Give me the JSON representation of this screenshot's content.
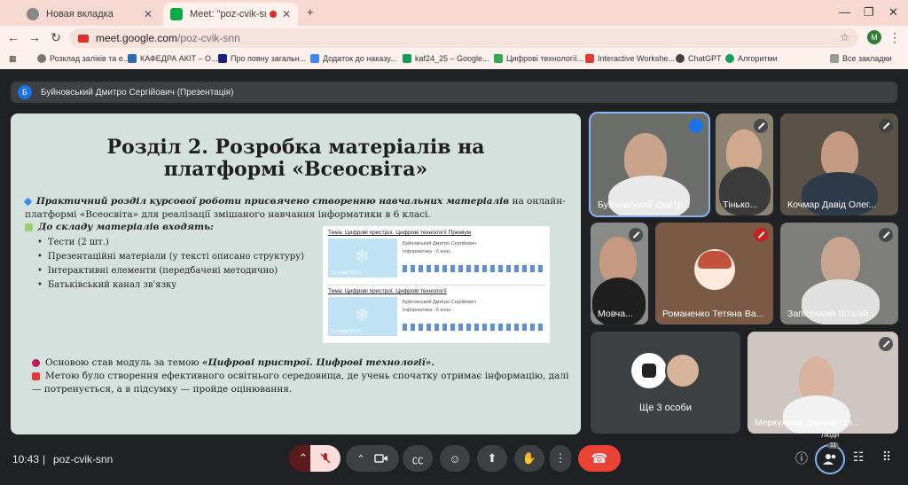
{
  "browser": {
    "tabs": [
      {
        "title": "Новая вкладка"
      },
      {
        "title": "Meet: \"poz-cvik-snn\""
      }
    ],
    "url_host": "meet.google.com",
    "url_path": "/poz-cvik-snn",
    "profile_initial": "M",
    "bookmarks": [
      "Розклад заліків та е...",
      "КАФЕДРА АКІТ – О...",
      "Про повну загальн...",
      "Додаток до наказу...",
      "kaf24_25 – Google...",
      "Цифрові технології...",
      "Interactive Workshe...",
      "ChatGPT",
      "Алгоритми"
    ],
    "all_bookmarks": "Все закладки"
  },
  "meet": {
    "presenter_initial": "Б",
    "presenter_title": "Буйновський Дмитро Сергійович (Презентація)",
    "time": "10:43",
    "meeting_code": "poz-cvik-snn",
    "people_label": "Люди",
    "people_count": "11",
    "more_label": "Ще 3 особи"
  },
  "slide": {
    "title_line1": "Розділ 2. Розробка матеріалів на",
    "title_line2": "платформі «Всеосвіта»",
    "para1_bold": "Практичний розділ курсової роботи присвячено створенню навчальних матеріалів",
    "para1_rest": " на онлайн-платформі «Всеосвіта» для реалізації змішаного навчання інформатики в 6 класі.",
    "includes": "До складу матеріалів входять:",
    "items": [
      "Тести (2 шт.)",
      "Презентаційні матеріали (у тексті описано структуру)",
      "Інтерактивні елементи (передбачені методично)",
      "Батьківський канал зв'язку"
    ],
    "base_text": "Основою став модуль за темою ",
    "base_bold": "«Цифрові пристрої. Цифрові технології».",
    "goal_text": "Метою було створення ефективного освітнього середовища, де учень спочатку отримає інформацію, далі — потренується, а в підсумку — пройде оцінювання.",
    "card1_title": "Тема: Цифрові пристрої. Цифрові технології Преміум",
    "card2_title": "Тема: Цифрові пристрої. Цифрові технології",
    "card_author": "Буйновський Дмитро Сергійович",
    "card_subject": "Інформатика",
    "card_grade": "6 клас",
    "card1_date": "Сьогодні 08:22",
    "card2_date": "Сьогодні 09:40"
  },
  "participants": [
    {
      "name": "Буйновський Дмитр...",
      "muted": false
    },
    {
      "name": "Тінько...",
      "muted": true
    },
    {
      "name": "Кочмар Давід Олег...",
      "muted": true
    },
    {
      "name": "Мовча...",
      "muted": true
    },
    {
      "name": "Романенко Тетяна Ва...",
      "muted": true
    },
    {
      "name": "Запісочний Віталій...",
      "muted": true
    },
    {
      "name": "Меркулова Дарина Ол...",
      "muted": true
    }
  ],
  "colors": {
    "accent": "#8ab4f8",
    "end_call": "#ea4335",
    "slide_bg": "#d5e1dd"
  }
}
